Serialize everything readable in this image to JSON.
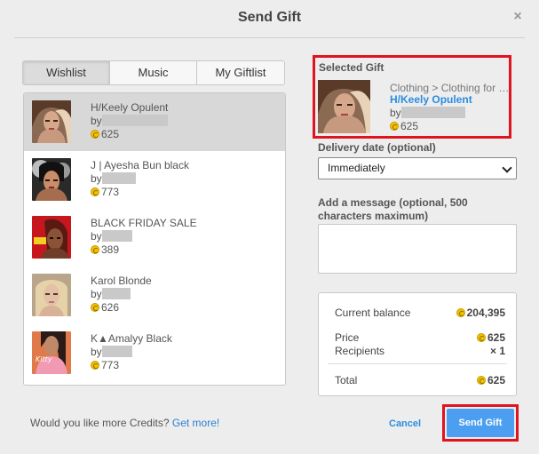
{
  "dialog": {
    "title": "Send Gift",
    "close_glyph": "×"
  },
  "tabs": [
    {
      "label": "Wishlist",
      "active": true
    },
    {
      "label": "Music",
      "active": false
    },
    {
      "label": "My Giftlist",
      "active": false
    }
  ],
  "items": [
    {
      "name": "H/Keely Opulent",
      "by": "by",
      "price": "625",
      "selected": true,
      "icon": "avatar-thumbnail"
    },
    {
      "name": "J | Ayesha Bun black",
      "by": "by",
      "price": "773",
      "selected": false,
      "icon": "avatar-thumbnail"
    },
    {
      "name": "BLACK FRIDAY SALE",
      "by": "by",
      "price": "389",
      "selected": false,
      "icon": "avatar-thumbnail"
    },
    {
      "name": "Karol Blonde",
      "by": "by",
      "price": "626",
      "selected": false,
      "icon": "avatar-thumbnail"
    },
    {
      "name": "K▲Amalyy Black",
      "by": "by",
      "price": "773",
      "selected": false,
      "icon": "avatar-thumbnail"
    }
  ],
  "footer": {
    "prompt": "Would you like more Credits?",
    "link": "Get more!"
  },
  "selected_gift": {
    "label": "Selected Gift",
    "category": "Clothing > Clothing for Females",
    "name": "H/Keely Opulent",
    "by": "by",
    "price": "625"
  },
  "delivery": {
    "label": "Delivery date (optional)",
    "value": "Immediately"
  },
  "message": {
    "label": "Add a message (optional, 500 characters maximum)",
    "value": ""
  },
  "summary": {
    "balance_label": "Current balance",
    "balance_value": "204,395",
    "price_label": "Price",
    "price_value": "625",
    "recipients_label": "Recipients",
    "recipients_value": "× 1",
    "total_label": "Total",
    "total_value": "625"
  },
  "actions": {
    "cancel": "Cancel",
    "send": "Send Gift"
  },
  "colors": {
    "accent": "#4c9ff0",
    "link": "#2a8de0",
    "highlight": "#e0141e",
    "coin": "#f2c200"
  }
}
